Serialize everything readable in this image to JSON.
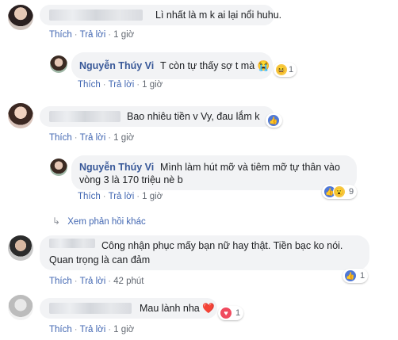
{
  "actions": {
    "like": "Thích",
    "reply": "Trả lời"
  },
  "more_replies": "Xem phản hồi khác",
  "comments": [
    {
      "text": "Lì nhất là m k ai lại nổi huhu.",
      "time": "1 giờ"
    },
    {
      "author": "Nguyễn Thúy Vi",
      "text": "T còn tự thấy sợ t mà 😭",
      "time": "1 giờ",
      "reaction_count": "1",
      "reactions": [
        "haha-icon"
      ]
    },
    {
      "text": "Bao nhiêu tiền v Vy, đau lắm k",
      "time": "1 giờ",
      "reactions": [
        "like-icon"
      ]
    },
    {
      "author": "Nguyễn Thúy Vi",
      "text_line1": "Mình làm hút mỡ và tiêm mỡ tự thân vào",
      "text_line2": "vòng 3 là 170 triệu nè b",
      "time": "1 giờ",
      "reaction_count": "9",
      "reactions": [
        "like-icon",
        "wow-icon"
      ]
    },
    {
      "text_line1": "Công nhận phục mấy bạn nữ hay thật. Tiền bạc ko nói.",
      "text_line2": "Quan trọng là can đảm",
      "time": "42 phút",
      "reaction_count": "1",
      "reactions": [
        "like-icon"
      ]
    },
    {
      "text": "Mau lành nha ❤️",
      "time": "1 giờ",
      "reaction_count": "1",
      "reactions": [
        "love-icon"
      ]
    }
  ],
  "colors": {
    "link": "#4267b2",
    "author": "#385898",
    "bubble": "#f2f3f5",
    "meta": "#616770"
  }
}
